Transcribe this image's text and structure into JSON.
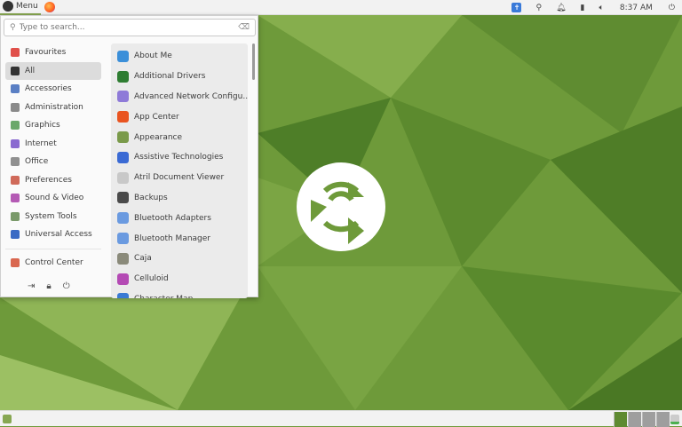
{
  "top_panel": {
    "menu_label": "Menu",
    "clock": "8:37 AM"
  },
  "search": {
    "placeholder": "Type to search..."
  },
  "categories": [
    {
      "label": "Favourites",
      "color": "#e0504a"
    },
    {
      "label": "All",
      "color": "#333333",
      "selected": true
    },
    {
      "label": "Accessories",
      "color": "#5a7fc4"
    },
    {
      "label": "Administration",
      "color": "#8a8a8a"
    },
    {
      "label": "Graphics",
      "color": "#6aa86a"
    },
    {
      "label": "Internet",
      "color": "#8a6ad0"
    },
    {
      "label": "Office",
      "color": "#909090"
    },
    {
      "label": "Preferences",
      "color": "#d06a5a"
    },
    {
      "label": "Sound & Video",
      "color": "#b45ab4"
    },
    {
      "label": "System Tools",
      "color": "#7a9a6a"
    },
    {
      "label": "Universal Access",
      "color": "#3a6ac4"
    }
  ],
  "control_center": {
    "label": "Control Center",
    "color": "#d9674f"
  },
  "apps": [
    {
      "label": "About Me",
      "color": "#3b8fd9"
    },
    {
      "label": "Additional Drivers",
      "color": "#2e7d32"
    },
    {
      "label": "Advanced Network Configu...",
      "color": "#8e7ad8"
    },
    {
      "label": "App Center",
      "color": "#e95420"
    },
    {
      "label": "Appearance",
      "color": "#7a9a4a"
    },
    {
      "label": "Assistive Technologies",
      "color": "#3a6ad4"
    },
    {
      "label": "Atril Document Viewer",
      "color": "#c8c8c8"
    },
    {
      "label": "Backups",
      "color": "#4a4a4a"
    },
    {
      "label": "Bluetooth Adapters",
      "color": "#6a9ae0"
    },
    {
      "label": "Bluetooth Manager",
      "color": "#6a9ae0"
    },
    {
      "label": "Caja",
      "color": "#8a8a7a"
    },
    {
      "label": "Celluloid",
      "color": "#b44ab4"
    },
    {
      "label": "Character Map",
      "color": "#3a7ad4"
    }
  ],
  "colors": {
    "accent": "#87a752",
    "desktop": "#6f9a3a"
  }
}
